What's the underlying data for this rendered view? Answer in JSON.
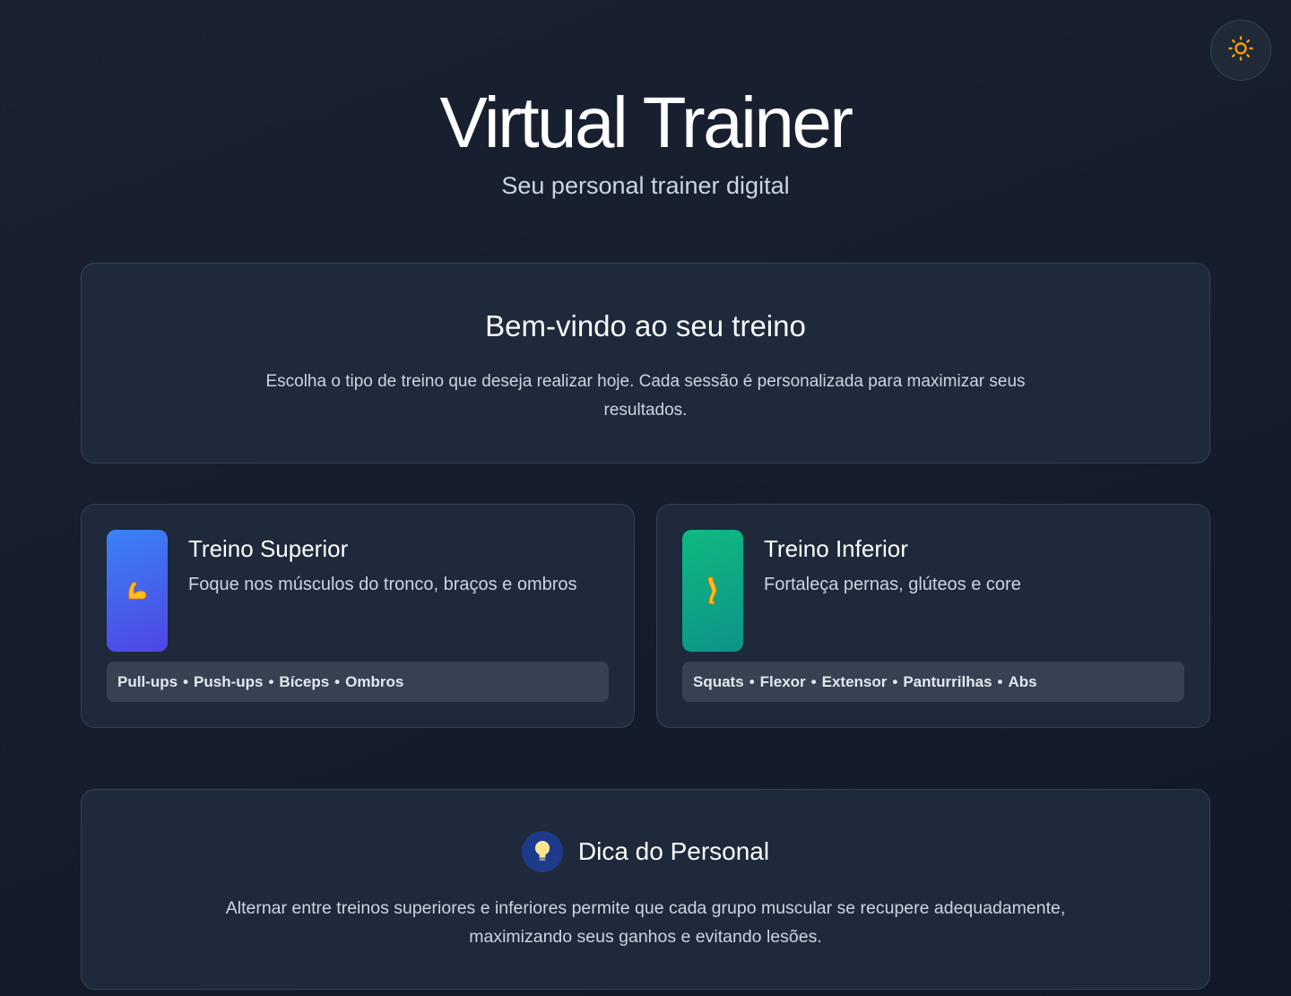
{
  "header": {
    "title": "Virtual Trainer",
    "subtitle": "Seu personal trainer digital"
  },
  "theme_toggle": {
    "icon": "sun-icon",
    "color": "#f59e0b"
  },
  "welcome": {
    "heading": "Bem-vindo ao seu treino",
    "text": "Escolha o tipo de treino que deseja realizar hoje. Cada sessão é personalizada para maximizar seus resultados."
  },
  "workouts": [
    {
      "title": "Treino Superior",
      "description": "Foque nos músculos do tronco, braços e ombros",
      "icon": "flexed-biceps-icon",
      "accent": "#3b82f6",
      "exercises": [
        "Pull-ups",
        "Push-ups",
        "Bíceps",
        "Ombros"
      ]
    },
    {
      "title": "Treino Inferior",
      "description": "Fortaleça pernas, glúteos e core",
      "icon": "leg-icon",
      "accent": "#10b981",
      "exercises": [
        "Squats",
        "Flexor",
        "Extensor",
        "Panturrilhas",
        "Abs"
      ]
    }
  ],
  "tip": {
    "heading": "Dica do Personal",
    "icon": "light-bulb-icon",
    "text": "Alternar entre treinos superiores e inferiores permite que cada grupo muscular se recupere adequadamente, maximizando seus ganhos e evitando lesões."
  }
}
